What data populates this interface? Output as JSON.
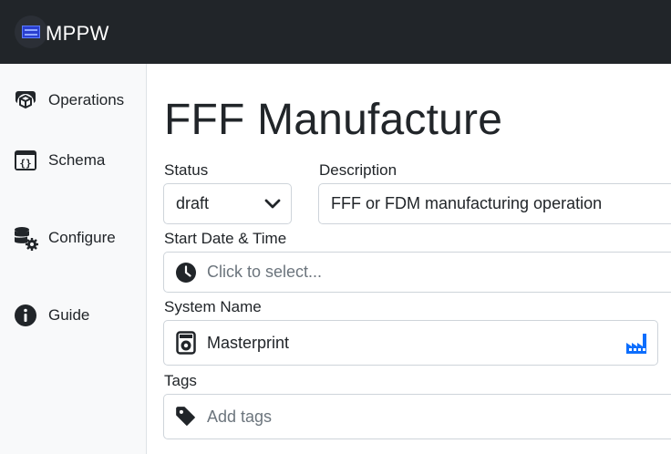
{
  "header": {
    "brand": "MPPW",
    "logo_icon": "cube-logo-icon"
  },
  "sidebar": {
    "items": [
      {
        "label": "Operations",
        "icon": "box-gear-icon"
      },
      {
        "label": "Schema",
        "icon": "code-braces-icon"
      },
      {
        "label": "Configure",
        "icon": "database-gear-icon"
      },
      {
        "label": "Guide",
        "icon": "info-circle-icon"
      }
    ]
  },
  "form": {
    "title": "FFF Manufacture",
    "status": {
      "label": "Status",
      "value": "draft"
    },
    "description": {
      "label": "Description",
      "value": "FFF or FDM manufacturing operation"
    },
    "start": {
      "label": "Start Date & Time",
      "placeholder": "Click to select..."
    },
    "system": {
      "label": "System Name",
      "value": "Masterprint"
    },
    "tags": {
      "label": "Tags",
      "placeholder": "Add tags"
    }
  },
  "colors": {
    "topbar": "#212529",
    "sidebar": "#f8f9fa",
    "accent": "#0d6efd"
  }
}
